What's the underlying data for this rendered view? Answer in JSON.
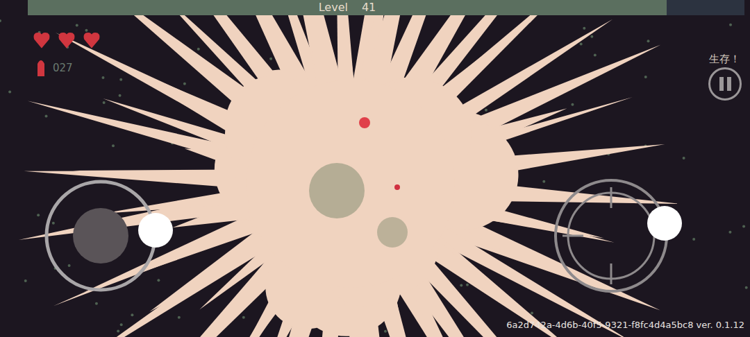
{
  "hud": {
    "level_label": "Level",
    "level": "41",
    "hearts": [
      {
        "full": true
      },
      {
        "full": true
      },
      {
        "full": true
      }
    ],
    "ammo": "027",
    "objective": "生存！",
    "build": "6a2d742a-4d6b-40f5-9321-f8fc4d4a5bc8 ver. 0.1.12"
  }
}
